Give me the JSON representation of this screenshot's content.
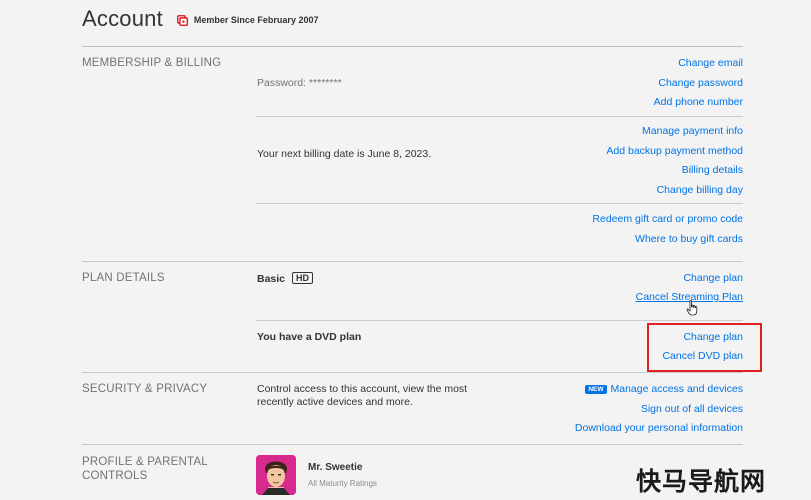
{
  "header": {
    "title": "Account",
    "member_since": "Member Since February 2007"
  },
  "membership": {
    "label": "MEMBERSHIP & BILLING",
    "password": "Password: ********",
    "billing_date": "Your next billing date is June 8, 2023.",
    "links": {
      "change_email": "Change email",
      "change_password": "Change password",
      "add_phone": "Add phone number",
      "manage_payment": "Manage payment info",
      "add_backup_payment": "Add backup payment method",
      "billing_details": "Billing details",
      "change_billing_day": "Change billing day",
      "redeem_gift": "Redeem gift card or promo code",
      "where_buy_gift": "Where to buy gift cards"
    }
  },
  "plan": {
    "label": "PLAN DETAILS",
    "streaming_plan": "Basic",
    "hd_badge": "HD",
    "dvd_plan": "You have a DVD plan",
    "links": {
      "change_plan_streaming": "Change plan",
      "cancel_streaming": "Cancel Streaming Plan",
      "change_plan_dvd": "Change plan",
      "cancel_dvd": "Cancel DVD plan"
    }
  },
  "security": {
    "label": "SECURITY & PRIVACY",
    "description_line1": "Control access to this account, view the most",
    "description_line2": "recently active devices and more.",
    "new_badge": "NEW",
    "links": {
      "manage_access": "Manage access and devices",
      "sign_out_all": "Sign out of all devices",
      "download_info": "Download your personal information"
    }
  },
  "profile": {
    "label_line1": "PROFILE & PARENTAL",
    "label_line2": "CONTROLS",
    "name": "Mr. Sweetie",
    "ratings": "All Maturity Ratings"
  },
  "watermark": "快马导航网",
  "colors": {
    "link": "#0073e6",
    "highlight": "#e02020",
    "member_icon": "#e50914",
    "background": "#f3f3f3"
  }
}
